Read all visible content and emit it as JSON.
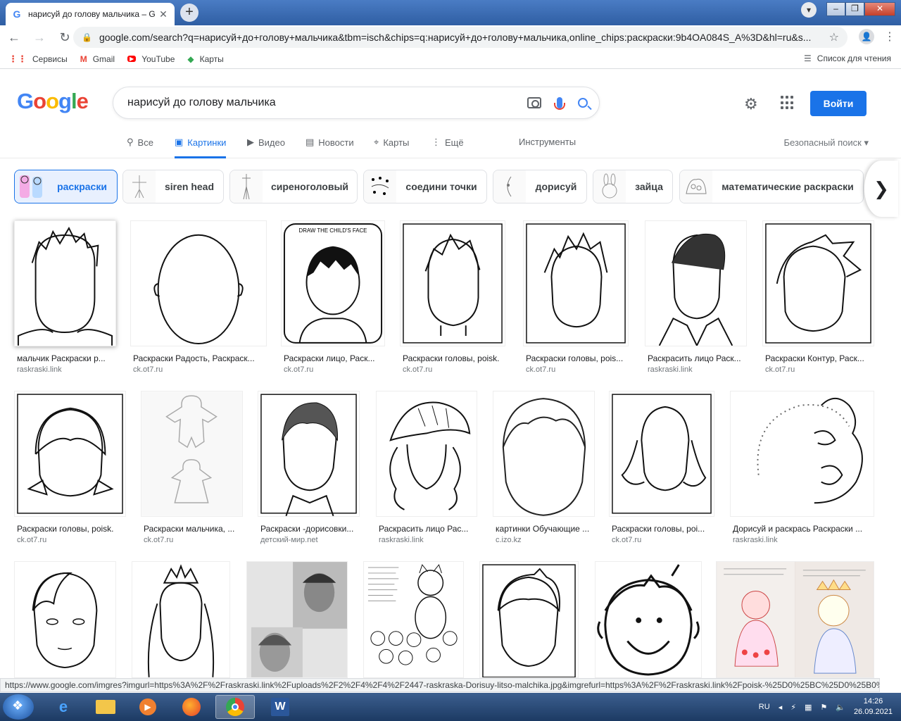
{
  "browser": {
    "tab_title": "нарисуй до голову мальчика – G",
    "url": "google.com/search?q=нарисуй+до+голову+мальчика&tbm=isch&chips=q:нарисуй+до+голову+мальчика,online_chips:раскраски:9b4OA084S_A%3D&hl=ru&s...",
    "bookmarks": [
      {
        "label": "Сервисы",
        "icon": "apps-grid-icon"
      },
      {
        "label": "Gmail",
        "icon": "gmail-icon"
      },
      {
        "label": "YouTube",
        "icon": "youtube-icon"
      },
      {
        "label": "Карты",
        "icon": "maps-icon"
      }
    ],
    "reading_list": "Список для чтения"
  },
  "search": {
    "query": "нарисуй до голову мальчика",
    "login_label": "Войти",
    "tabs": [
      {
        "label": "Все",
        "icon": "search-icon"
      },
      {
        "label": "Картинки",
        "icon": "image-icon"
      },
      {
        "label": "Видео",
        "icon": "video-icon"
      },
      {
        "label": "Новости",
        "icon": "news-icon"
      },
      {
        "label": "Карты",
        "icon": "map-pin-icon"
      },
      {
        "label": "Ещё",
        "icon": "more-icon"
      }
    ],
    "tools": "Инструменты",
    "safe_search": "Безопасный поиск ▾"
  },
  "chips": [
    {
      "label": "раскраски"
    },
    {
      "label": "siren head"
    },
    {
      "label": "сиреноголовый"
    },
    {
      "label": "соедини точки"
    },
    {
      "label": "дорисуй"
    },
    {
      "label": "зайца"
    },
    {
      "label": "математические раскраски"
    }
  ],
  "results": [
    {
      "title": "мальчик Раскраски р...",
      "source": "raskraski.link"
    },
    {
      "title": "Раскраски Радость, Раскраск...",
      "source": "ck.ot7.ru"
    },
    {
      "title": "Раскраски лицо, Раск...",
      "source": "ck.ot7.ru",
      "caption": "DRAW THE CHILD'S FACE"
    },
    {
      "title": "Раскраски головы, poisk.",
      "source": "ck.ot7.ru"
    },
    {
      "title": "Раскраски головы, pois...",
      "source": "ck.ot7.ru"
    },
    {
      "title": "Раскрасить лицо Раск...",
      "source": "raskraski.link"
    },
    {
      "title": "Раскраски Контур, Раск...",
      "source": "ck.ot7.ru"
    },
    {
      "title": "Раскраски головы, poisk.",
      "source": "ck.ot7.ru"
    },
    {
      "title": "Раскраски мальчика, ...",
      "source": "ck.ot7.ru"
    },
    {
      "title": "Раскраски -дорисовки...",
      "source": "детский-мир.net"
    },
    {
      "title": "Раскрасить лицо Рас...",
      "source": "raskraski.link"
    },
    {
      "title": "картинки Обучающие ...",
      "source": "c.izo.kz"
    },
    {
      "title": "Раскраски головы, poi...",
      "source": "ck.ot7.ru"
    },
    {
      "title": "Дорисуй и раскрась Раскраски ...",
      "source": "raskraski.link"
    },
    {
      "title": "",
      "source": ""
    },
    {
      "title": "",
      "source": ""
    },
    {
      "title": "",
      "source": ""
    },
    {
      "title": "",
      "source": ""
    },
    {
      "title": "",
      "source": ""
    },
    {
      "title": "",
      "source": ""
    },
    {
      "title": "",
      "source": ""
    }
  ],
  "status_url": "https://www.google.com/imgres?imgurl=https%3A%2F%2Fraskraski.link%2Fuploads%2F2%2F4%2F4%2F2447-raskraska-Dorisuy-litso-malchika.jpg&imgrefurl=https%3A%2F%2Fraskraski.link%2Fpoisk-%25D0%25BC%25D0%25B0%2...",
  "taskbar": {
    "lang": "RU",
    "time": "14:26",
    "date": "26.09.2021"
  }
}
